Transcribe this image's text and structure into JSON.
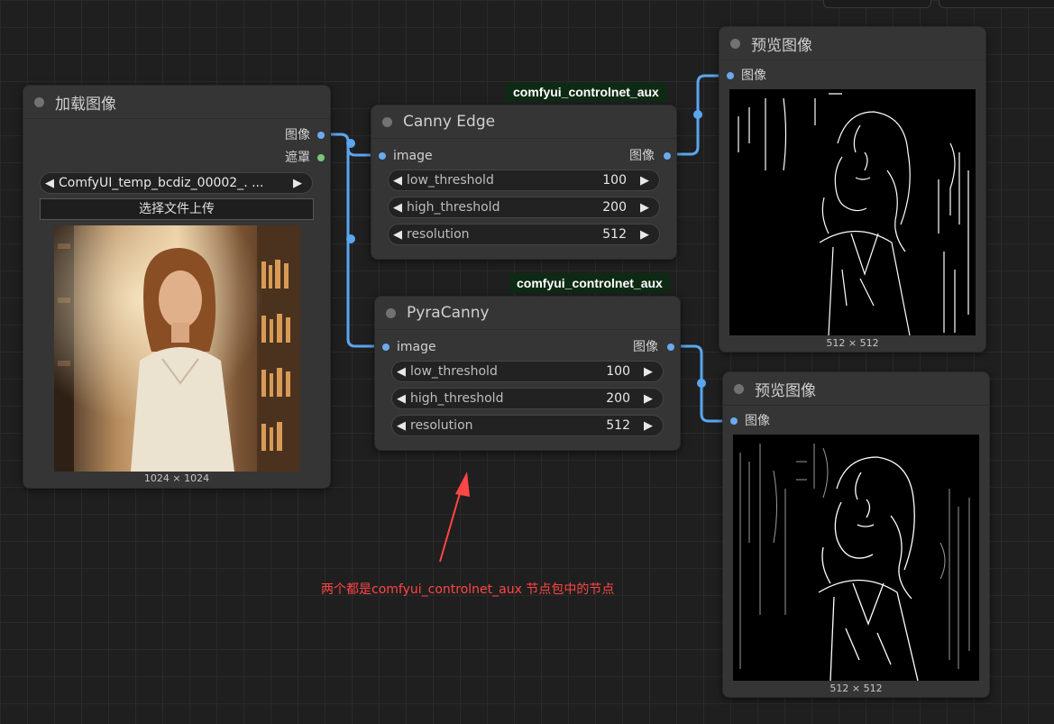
{
  "load_node": {
    "title": "加载图像",
    "outputs": [
      "图像",
      "遮罩"
    ],
    "file_value": "ComfyUI_temp_bcdiz_00002_. ...",
    "upload_label": "选择文件上传",
    "dims": "1024 × 1024"
  },
  "canny_node": {
    "badge": "comfyui_controlnet_aux",
    "title": "Canny Edge",
    "input": "image",
    "output": "图像",
    "widgets": [
      {
        "label": "low_threshold",
        "value": "100"
      },
      {
        "label": "high_threshold",
        "value": "200"
      },
      {
        "label": "resolution",
        "value": "512"
      }
    ]
  },
  "pyra_node": {
    "badge": "comfyui_controlnet_aux",
    "title": "PyraCanny",
    "input": "image",
    "output": "图像",
    "widgets": [
      {
        "label": "low_threshold",
        "value": "100"
      },
      {
        "label": "high_threshold",
        "value": "200"
      },
      {
        "label": "resolution",
        "value": "512"
      }
    ]
  },
  "preview1": {
    "title": "预览图像",
    "input": "图像",
    "dims": "512 × 512"
  },
  "preview2": {
    "title": "预览图像",
    "input": "图像",
    "dims": "512 × 512"
  },
  "annotation": "两个都是comfyui_controlnet_aux 节点包中的节点",
  "colors": {
    "wire": "#5aa6f0",
    "node_bg": "#353535",
    "badge_bg": "#0f2a14",
    "annotation": "#ff4545"
  },
  "icons": {
    "arrow_left": "◀",
    "arrow_right": "▶"
  }
}
